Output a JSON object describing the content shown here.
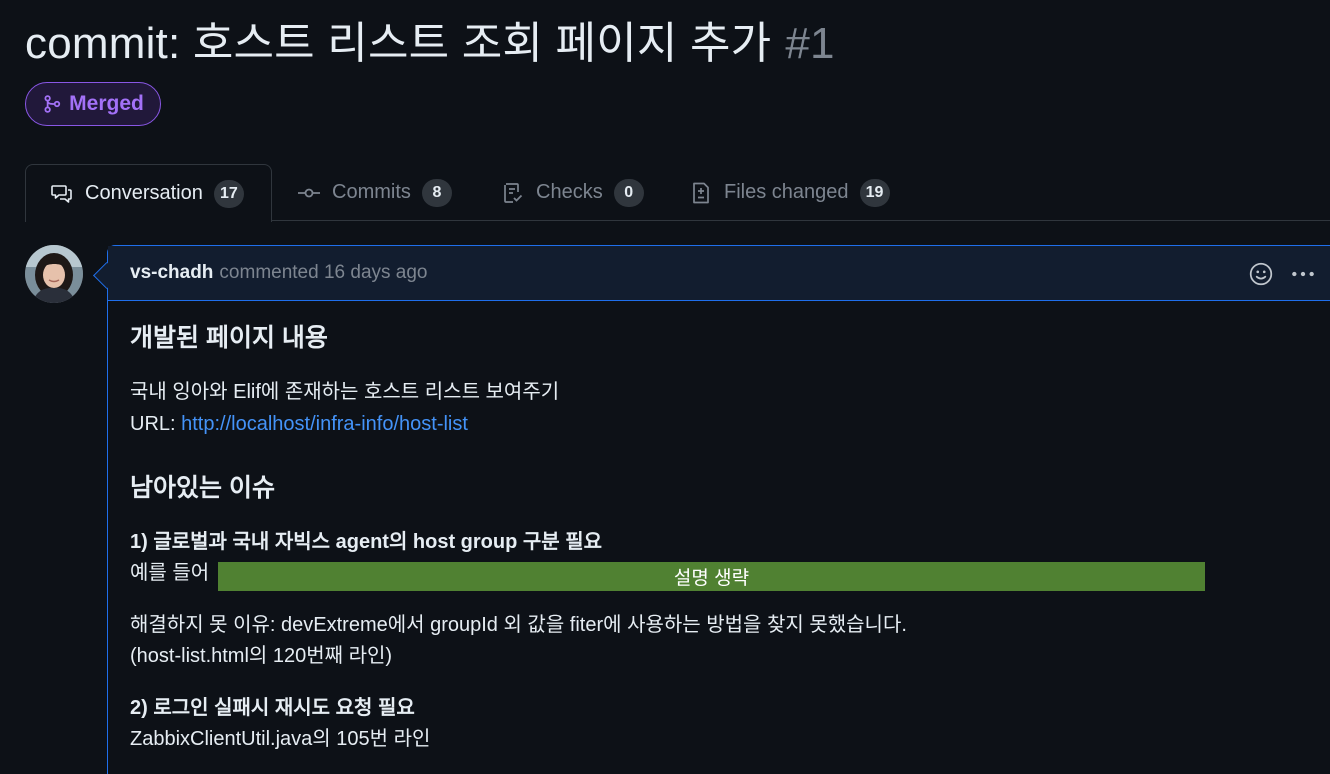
{
  "pr": {
    "title": "commit: 호스트 리스트 조회 페이지 추가",
    "number": "#1",
    "state": "Merged"
  },
  "tabs": [
    {
      "label": "Conversation",
      "count": "17",
      "icon": "comment-discussion-icon"
    },
    {
      "label": "Commits",
      "count": "8",
      "icon": "git-commit-icon"
    },
    {
      "label": "Checks",
      "count": "0",
      "icon": "checklist-icon"
    },
    {
      "label": "Files changed",
      "count": "19",
      "icon": "file-diff-icon"
    }
  ],
  "comment": {
    "author": "vs-chadh",
    "meta": "commented 16 days ago",
    "body": {
      "heading1": "개발된 페이지 내용",
      "line1": "국내 잉아와 Elif에 존재하는 호스트 리스트 보여주기",
      "url_prefix": "URL: ",
      "url_text": "http://localhost/infra-info/host-list",
      "heading2": "남아있는 이슈",
      "issue1_title": "1) 글로벌과 국내 자빅스 agent의 host group 구분 필요",
      "issue1_prefix": "예를 들어",
      "issue1_redacted": "설명 생략",
      "issue1_reason": "해결하지 못 이유: devExtreme에서 groupId 외 값을 fiter에 사용하는 방법을 찾지 못했습니다.",
      "issue1_ref": "(host-list.html의 120번째 라인)",
      "issue2_title": "2) 로그인 실패시 재시도 요청 필요",
      "issue2_ref": "ZabbixClientUtil.java의 105번 라인"
    }
  },
  "colors": {
    "background": "#0d1117",
    "merged": "#a371f7",
    "link": "#4493f8",
    "accent_border": "#1f6feb",
    "redaction": "#508132"
  }
}
